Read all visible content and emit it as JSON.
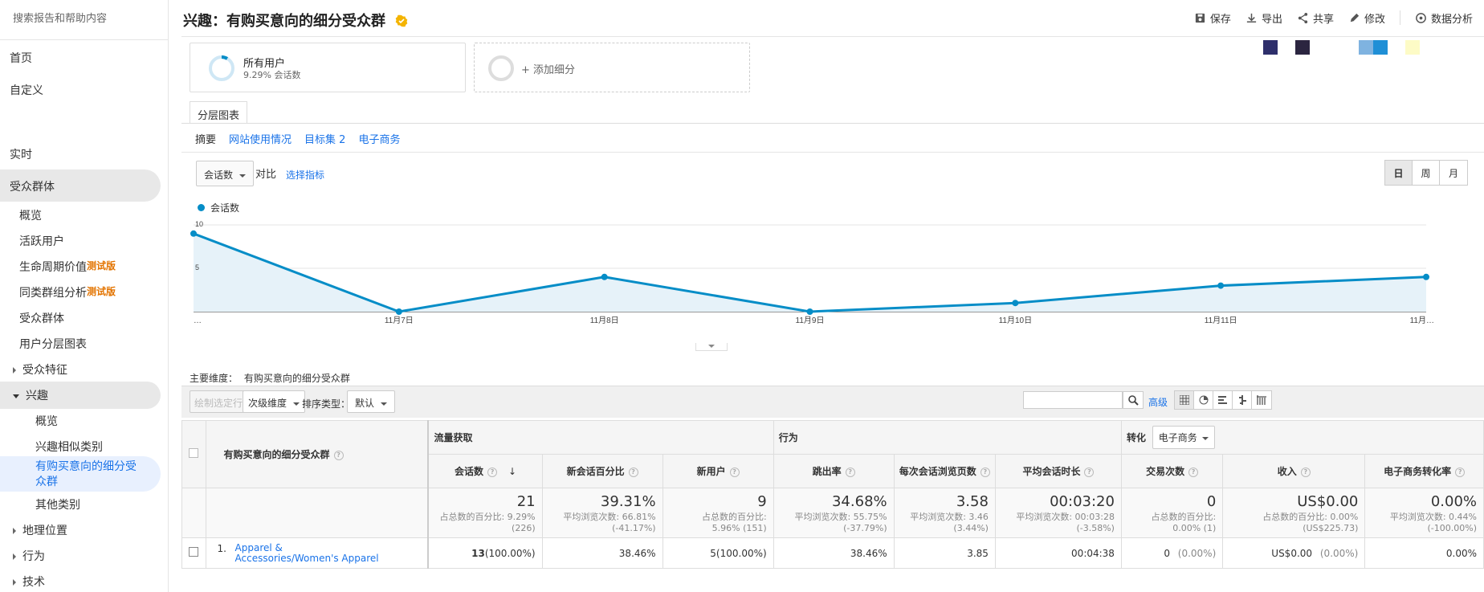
{
  "sidebar": {
    "search_placeholder": "搜索报告和帮助内容",
    "home": "首页",
    "custom": "自定义",
    "realtime": "实时",
    "audience": "受众群体",
    "audience_items": [
      {
        "label": "概览"
      },
      {
        "label": "活跃用户"
      },
      {
        "label": "生命周期价值",
        "badge": "测试版"
      },
      {
        "label": "同类群组分析",
        "badge": "测试版"
      },
      {
        "label": "受众群体"
      },
      {
        "label": "用户分层图表"
      }
    ],
    "demographics": "受众特征",
    "interests": "兴趣",
    "interests_items": [
      "概览",
      "兴趣相似类别",
      "有购买意向的细分受众群",
      "其他类别"
    ],
    "geo": "地理位置",
    "behavior": "行为",
    "technology": "技术"
  },
  "header": {
    "title": "兴趣：有购买意向的细分受众群",
    "actions": [
      "保存",
      "导出",
      "共享",
      "修改",
      "数据分析"
    ]
  },
  "segments": {
    "all_users": "所有用户",
    "all_users_sub": "9.29% 会话数",
    "add_segment": "+ 添加细分"
  },
  "swatch_colors": [
    "#2e2f6b",
    "#2b2540",
    "#7fb3e0",
    "#1f8fd6",
    "#fdfbc6"
  ],
  "tab": "分层图表",
  "subtabs": [
    "摘要",
    "网站使用情况",
    "目标集 2",
    "电子商务"
  ],
  "metric": {
    "selected": "会话数",
    "vs": "对比",
    "select": "选择指标"
  },
  "period": [
    "日",
    "周",
    "月"
  ],
  "chart_data": {
    "type": "area",
    "series": [
      {
        "name": "会话数",
        "values": [
          9,
          0,
          4,
          0,
          1,
          3,
          4
        ]
      }
    ],
    "x": [
      "…",
      "11月7日",
      "11月8日",
      "11月9日",
      "11月10日",
      "11月11日",
      "11月…"
    ],
    "ylim": [
      0,
      10
    ],
    "yticks": [
      "10",
      "5"
    ],
    "color": "#058dc7"
  },
  "primary_dim": {
    "label": "主要维度：",
    "value": "有购买意向的细分受众群"
  },
  "toolbar": {
    "plot_rows": "绘制选定行",
    "secondary_dim": "次级维度",
    "sort_type": "排序类型：",
    "sort_default": "默认",
    "advanced": "高级"
  },
  "table": {
    "dim_header": "有购买意向的细分受众群",
    "groups": {
      "acq": "流量获取",
      "beh": "行为",
      "conv": "转化",
      "conv_select": "电子商务"
    },
    "columns": [
      "会话数",
      "新会话百分比",
      "新用户",
      "跳出率",
      "每次会话浏览页数",
      "平均会话时长",
      "交易次数",
      "收入",
      "电子商务转化率"
    ],
    "totals": [
      {
        "main": "21",
        "sub1": "占总数的百分比: 9.29%",
        "sub2": "(226)"
      },
      {
        "main": "39.31%",
        "sub1": "平均浏览次数: 66.81%",
        "sub2": "(-41.17%)"
      },
      {
        "main": "9",
        "sub1": "占总数的百分比:",
        "sub2": "5.96% (151)"
      },
      {
        "main": "34.68%",
        "sub1": "平均浏览次数: 55.75%",
        "sub2": "(-37.79%)"
      },
      {
        "main": "3.58",
        "sub1": "平均浏览次数: 3.46",
        "sub2": "(3.44%)"
      },
      {
        "main": "00:03:20",
        "sub1": "平均浏览次数: 00:03:28",
        "sub2": "(-3.58%)"
      },
      {
        "main": "0",
        "sub1": "占总数的百分比:",
        "sub2": "0.00% (1)"
      },
      {
        "main": "US$0.00",
        "sub1": "占总数的百分比: 0.00%",
        "sub2": "(US$225.73)"
      },
      {
        "main": "0.00%",
        "sub1": "平均浏览次数: 0.44%",
        "sub2": "(-100.00%)"
      }
    ],
    "row": {
      "index": "1.",
      "name": "Apparel & Accessories/Women's Apparel",
      "sessions": "13",
      "sessions_pct": "(100.00%)",
      "new_pct": "38.46%",
      "new_users": "5",
      "new_users_pct": "(100.00%)",
      "bounce": "38.46%",
      "pages": "3.85",
      "duration": "00:04:38",
      "tx": "0",
      "tx_pct": "(0.00%)",
      "revenue": "US$0.00",
      "revenue_pct": "(0.00%)",
      "conv_rate": "0.00%"
    }
  }
}
